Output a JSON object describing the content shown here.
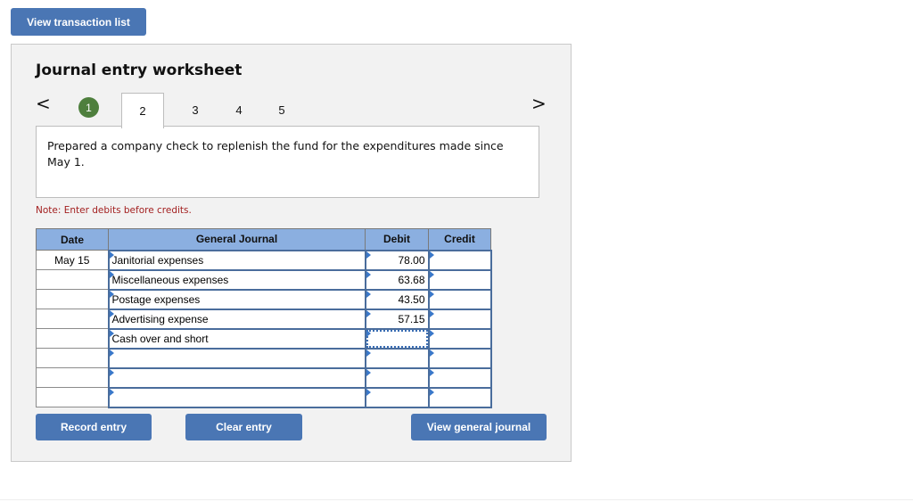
{
  "top_button": "View transaction list",
  "worksheet": {
    "title": "Journal entry worksheet",
    "nav": {
      "prev_icon": "chevron-left-icon",
      "next_icon": "chevron-right-icon",
      "prev": "<",
      "next": ">"
    },
    "steps": [
      {
        "label": "1",
        "state": "completed"
      },
      {
        "label": "2",
        "state": "active"
      },
      {
        "label": "3",
        "state": "pending"
      },
      {
        "label": "4",
        "state": "pending"
      },
      {
        "label": "5",
        "state": "pending"
      }
    ],
    "description": "Prepared a company check to replenish the fund for the expenditures made since May 1.",
    "note": "Note: Enter debits before credits.",
    "table": {
      "headers": {
        "date": "Date",
        "account": "General Journal",
        "debit": "Debit",
        "credit": "Credit"
      },
      "rows": [
        {
          "date": "May 15",
          "account": "Janitorial expenses",
          "debit": "78.00",
          "credit": ""
        },
        {
          "date": "",
          "account": "Miscellaneous expenses",
          "debit": "63.68",
          "credit": ""
        },
        {
          "date": "",
          "account": "Postage expenses",
          "debit": "43.50",
          "credit": ""
        },
        {
          "date": "",
          "account": "Advertising expense",
          "debit": "57.15",
          "credit": ""
        },
        {
          "date": "",
          "account": "Cash over and short",
          "debit": "",
          "credit": ""
        },
        {
          "date": "",
          "account": "",
          "debit": "",
          "credit": ""
        },
        {
          "date": "",
          "account": "",
          "debit": "",
          "credit": ""
        },
        {
          "date": "",
          "account": "",
          "debit": "",
          "credit": ""
        }
      ]
    },
    "buttons": {
      "record": "Record entry",
      "clear": "Clear entry",
      "view_journal": "View general journal"
    }
  },
  "colors": {
    "button_blue": "#4a76b4",
    "header_blue": "#8bafe0",
    "step_done_green": "#4e7f3d",
    "note_red": "#a32020"
  }
}
